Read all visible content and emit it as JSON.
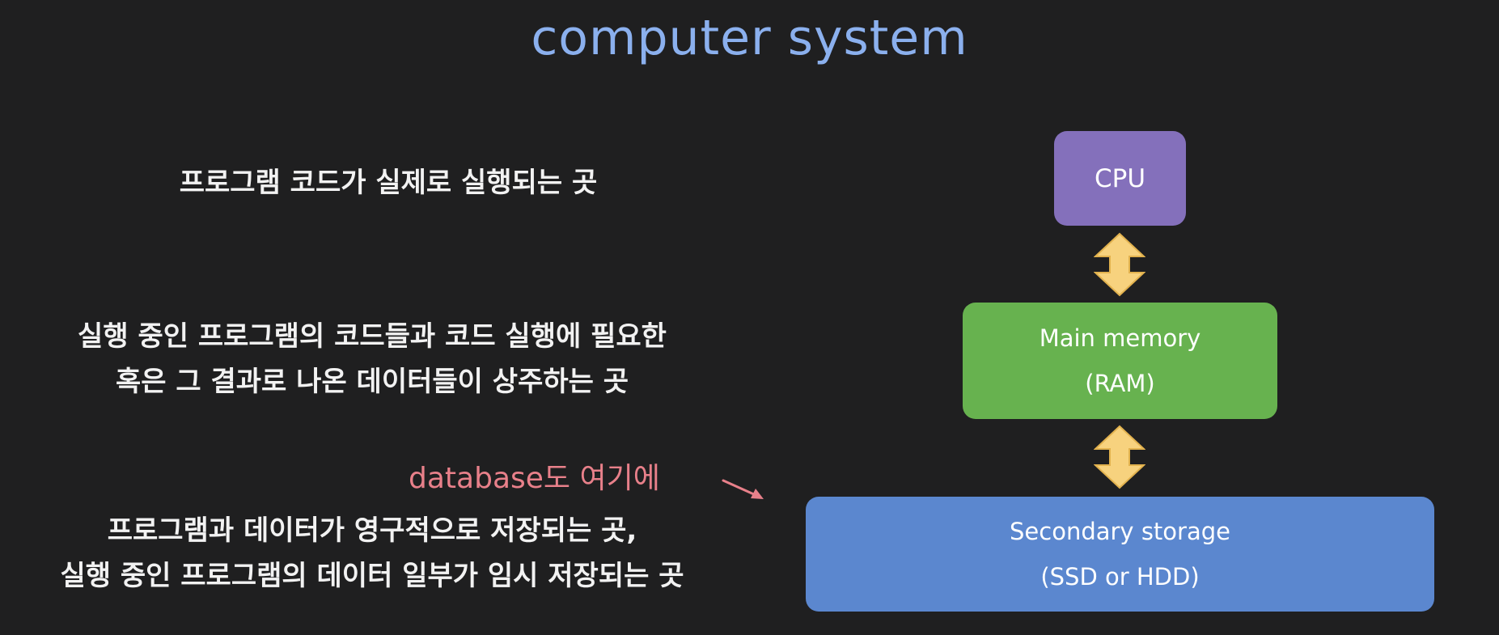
{
  "title": "computer system",
  "descriptions": {
    "cpu": "프로그램 코드가 실제로 실행되는 곳",
    "ram_line1": "실행 중인 프로그램의 코드들과 코드 실행에 필요한",
    "ram_line2": "혹은 그 결과로 나온 데이터들이 상주하는 곳",
    "storage_line1": "프로그램과 데이터가 영구적으로 저장되는 곳,",
    "storage_line2": "실행 중인 프로그램의 데이터 일부가 임시 저장되는 곳"
  },
  "annotation": "database도 여기에",
  "boxes": {
    "cpu": {
      "label": "CPU",
      "color": "#8470bb"
    },
    "ram": {
      "label_line1": "Main memory",
      "label_line2": "(RAM)",
      "color": "#67b24f"
    },
    "storage": {
      "label_line1": "Secondary storage",
      "label_line2": "(SSD or HDD)",
      "color": "#5b87cf"
    }
  },
  "colors": {
    "background": "#1f1f20",
    "title": "#8bb0ee",
    "annotation": "#e8808a",
    "arrow_fill": "#f7d27e"
  },
  "icons": {
    "connector": "double-headed-vertical-arrow-icon",
    "pointer": "pointer-arrow-icon"
  }
}
